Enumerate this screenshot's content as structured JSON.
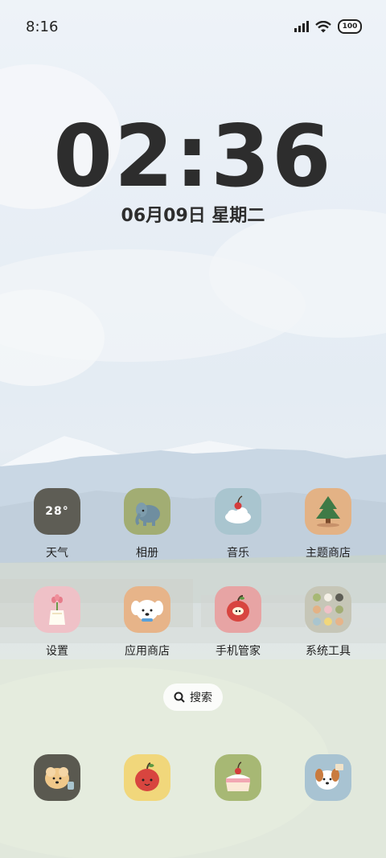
{
  "status_bar": {
    "time": "8:16",
    "battery": "100"
  },
  "lock_clock": {
    "time": "02:36",
    "date": "06月09日 星期二"
  },
  "apps_row1": [
    {
      "label": "天气",
      "icon": "weather-icon",
      "widget_text": "28°"
    },
    {
      "label": "相册",
      "icon": "elephant-gallery-icon"
    },
    {
      "label": "音乐",
      "icon": "cherry-cloud-music-icon"
    },
    {
      "label": "主题商店",
      "icon": "christmas-tree-theme-icon"
    }
  ],
  "apps_row2": [
    {
      "label": "设置",
      "icon": "tulip-vase-settings-icon"
    },
    {
      "label": "应用商店",
      "icon": "puppy-app-store-icon"
    },
    {
      "label": "手机管家",
      "icon": "apple-manager-icon"
    },
    {
      "label": "系统工具",
      "icon": "folder-icon"
    }
  ],
  "search": {
    "label": "搜索",
    "icon": "search-icon"
  },
  "dock": [
    {
      "icon": "puppy-cup-icon"
    },
    {
      "icon": "red-apple-icon"
    },
    {
      "icon": "cake-icon"
    },
    {
      "icon": "dog-dock-icon"
    }
  ],
  "colors": {
    "weather_bg": "#5e5d55",
    "gallery_bg": "#a2ad73",
    "music_bg": "#a9c5cf",
    "theme_bg": "#e3b285",
    "settings_bg": "#efc1c7",
    "appstore_bg": "#e7b489",
    "manager_bg": "#e7a4a4",
    "tools_bg": "#c6c6b7",
    "dock1_bg": "#5a5950",
    "dock2_bg": "#f1d77b",
    "dock3_bg": "#a7b874",
    "dock4_bg": "#a8c3d2"
  }
}
